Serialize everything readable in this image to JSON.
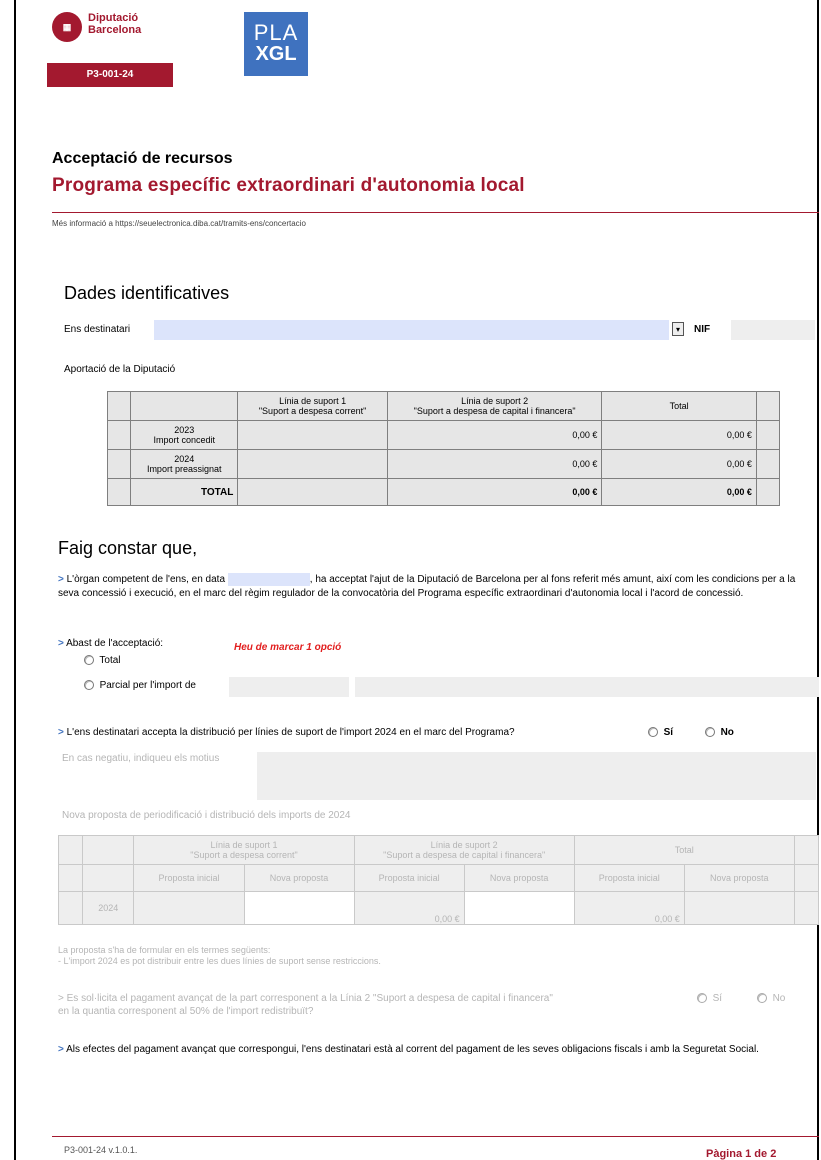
{
  "header": {
    "logo_line1": "Diputació",
    "logo_line2": "Barcelona",
    "pla_line1": "PLA",
    "pla_line2": "XGL",
    "code_badge": "P3-001-24"
  },
  "title": "Acceptació de recursos",
  "subtitle": "Programa específic extraordinari d'autonomia local",
  "info_text": "Més informació a https://seuelectronica.diba.cat/tramits-ens/concertacio",
  "section_identification": {
    "heading": "Dades identificatives",
    "ens_label": "Ens destinatari",
    "ens_value": "",
    "nif_label": "NIF",
    "nif_value": "",
    "contribution_label": "Aportació de la Diputació"
  },
  "contribution_table": {
    "col1_line1": "Línia de suport 1",
    "col1_line2": "\"Suport a despesa corrent\"",
    "col2_line1": "Línia de suport 2",
    "col2_line2": "\"Suport a despesa de capital i financera\"",
    "col3": "Total",
    "rows": [
      {
        "year": "2023",
        "label": "Import concedit",
        "l1": "",
        "l2": "0,00 €",
        "total": "0,00 €"
      },
      {
        "year": "2024",
        "label": "Import preassignat",
        "l1": "",
        "l2": "0,00 €",
        "total": "0,00 €"
      }
    ],
    "total_label": "TOTAL",
    "total_l1": "",
    "total_l2": "0,00 €",
    "total_total": "0,00 €"
  },
  "section_declaration": {
    "heading": "Faig constar que,",
    "para1_a": "L'òrgan competent de l'ens, en data",
    "para1_b": ", ha acceptat l'ajut de la Diputació de Barcelona per al fons referit més amunt, així com les condicions per a la seva concessió i execució, en el marc del règim regulador de la convocatòria del Programa específic extraordinari d'autonomia local i l'acord de concessió.",
    "scope_label": "Abast de l'acceptació:",
    "error_text": "Heu de marcar 1 opció",
    "option_total": "Total",
    "option_partial": "Parcial per l'import de",
    "distribution_question": "L'ens destinatari accepta la distribució per línies de suport de l'import 2024 en el marc del Programa?",
    "yes": "Sí",
    "no": "No",
    "negative_reasons": "En cas negatiu, indiqueu els motius",
    "new_proposal_title": "Nova proposta de periodificació i distribució dels imports de 2024"
  },
  "proposal_table": {
    "col1_line1": "Línia de suport 1",
    "col1_line2": "\"Suport a despesa corrent\"",
    "col2_line1": "Línia de suport 2",
    "col2_line2": "\"Suport a despesa de capital i financera\"",
    "col3": "Total",
    "initial": "Proposta inicial",
    "new": "Nova proposta",
    "row_year": "2024",
    "l2_initial": "0,00 €",
    "total_initial": "0,00 €"
  },
  "notes": {
    "line1": "La proposta s'ha de formular en els termes següents:",
    "line2": "- L'import 2024 es pot distribuir entre les dues línies de suport sense restriccions.",
    "advance_q1": "Es sol·licita el pagament avançat de la part corresponent a la Línia 2 \"Suport a despesa de capital i financera\"",
    "advance_q2": "en la quantia corresponent al 50% de l'import redistribuït?",
    "fiscal": "Als efectes del pagament avançat que correspongui, l'ens destinatari està al corrent del pagament de les seves obligacions fiscals i amb la Seguretat Social."
  },
  "footer": {
    "code": "P3-001-24 v.1.0.1.",
    "page": "Pàgina 1 de 2"
  },
  "colors": {
    "brand": "#a3192f",
    "accent": "#3f72bf",
    "field": "#dce4fb",
    "error": "#e21f1f"
  }
}
